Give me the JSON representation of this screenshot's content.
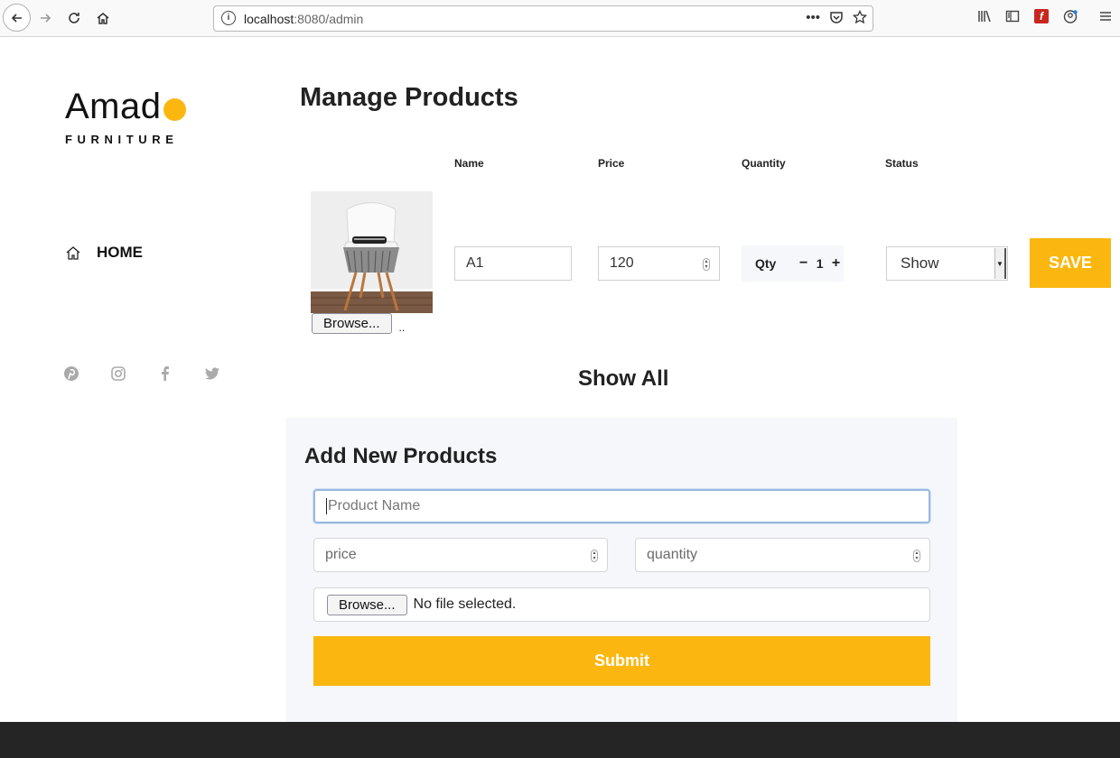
{
  "browser": {
    "url_host": "localhost",
    "url_path": ":8080/admin",
    "page_actions": "•••"
  },
  "brand": {
    "name": "Amado",
    "name_letters": "Amad",
    "subtitle": "FURNITURE",
    "accent_color": "#fbb710"
  },
  "sidebar": {
    "nav": [
      {
        "label": "HOME",
        "icon": "home-icon"
      }
    ],
    "socials": [
      "pinterest-icon",
      "instagram-icon",
      "facebook-icon",
      "twitter-icon"
    ]
  },
  "manage": {
    "title": "Manage Products",
    "columns": [
      "Name",
      "Price",
      "Quantity",
      "Status"
    ],
    "row": {
      "browse_label": "Browse...",
      "browse_suffix": "..",
      "name": "A1",
      "price": "120",
      "qty_label": "Qty",
      "qty_minus": "−",
      "qty_value": "1",
      "qty_plus": "+",
      "status": "Show",
      "save_label": "SAVE"
    },
    "show_all": "Show All"
  },
  "add_form": {
    "title": "Add New Products",
    "name_placeholder": "Product Name",
    "price_placeholder": "price",
    "quantity_placeholder": "quantity",
    "browse_label": "Browse...",
    "file_status": "No file selected.",
    "submit_label": "Submit"
  }
}
